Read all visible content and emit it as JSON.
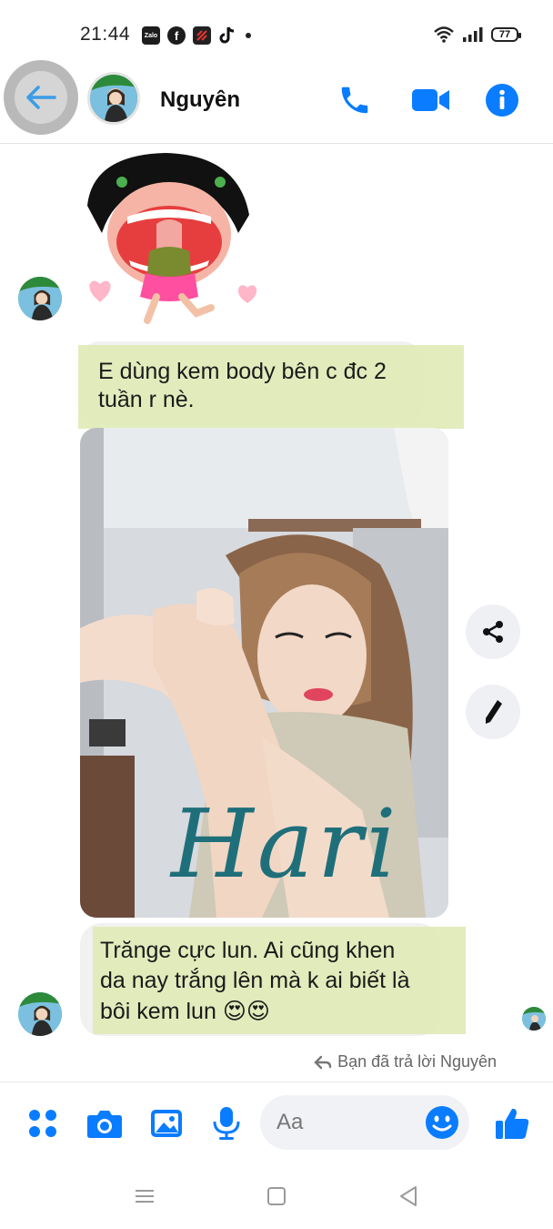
{
  "status_bar": {
    "time": "21:44",
    "app_icons": [
      "zalo-icon",
      "facebook-icon",
      "app-icon",
      "tiktok-icon"
    ],
    "battery": "77"
  },
  "header": {
    "contact_name": "Nguyên",
    "icons": [
      "back-arrow-icon",
      "phone-icon",
      "video-camera-icon",
      "info-icon"
    ]
  },
  "messages": [
    {
      "type": "sticker",
      "from": "contact",
      "icon": "sticker-girl-hearts"
    },
    {
      "type": "text",
      "from": "me",
      "text_line1": "E dùng kem body bên c đc 2",
      "text_line2": "tuần r nè."
    },
    {
      "type": "photo",
      "from": "me",
      "watermark": "Hari"
    },
    {
      "type": "text",
      "from": "contact",
      "line1": "Trănge cực lun. Ai cũng khen",
      "line2": "da nay trắng lên mà k ai biết là",
      "line3": "bôi kem lun",
      "emoji": "😍😍"
    }
  ],
  "actions": {
    "share_icon": "share-icon",
    "edit_icon": "pencil-icon"
  },
  "reply_note": "Bạn đã trả lời Nguyên",
  "composer": {
    "placeholder": "Aa",
    "icons": [
      "apps-grid-icon",
      "camera-icon",
      "gallery-icon",
      "microphone-icon",
      "emoji-icon",
      "thumbs-up-icon"
    ]
  },
  "colors": {
    "accent": "#0a7cff",
    "highlight": "#dfe9b4",
    "bubble_gray": "#f1f1f1"
  }
}
